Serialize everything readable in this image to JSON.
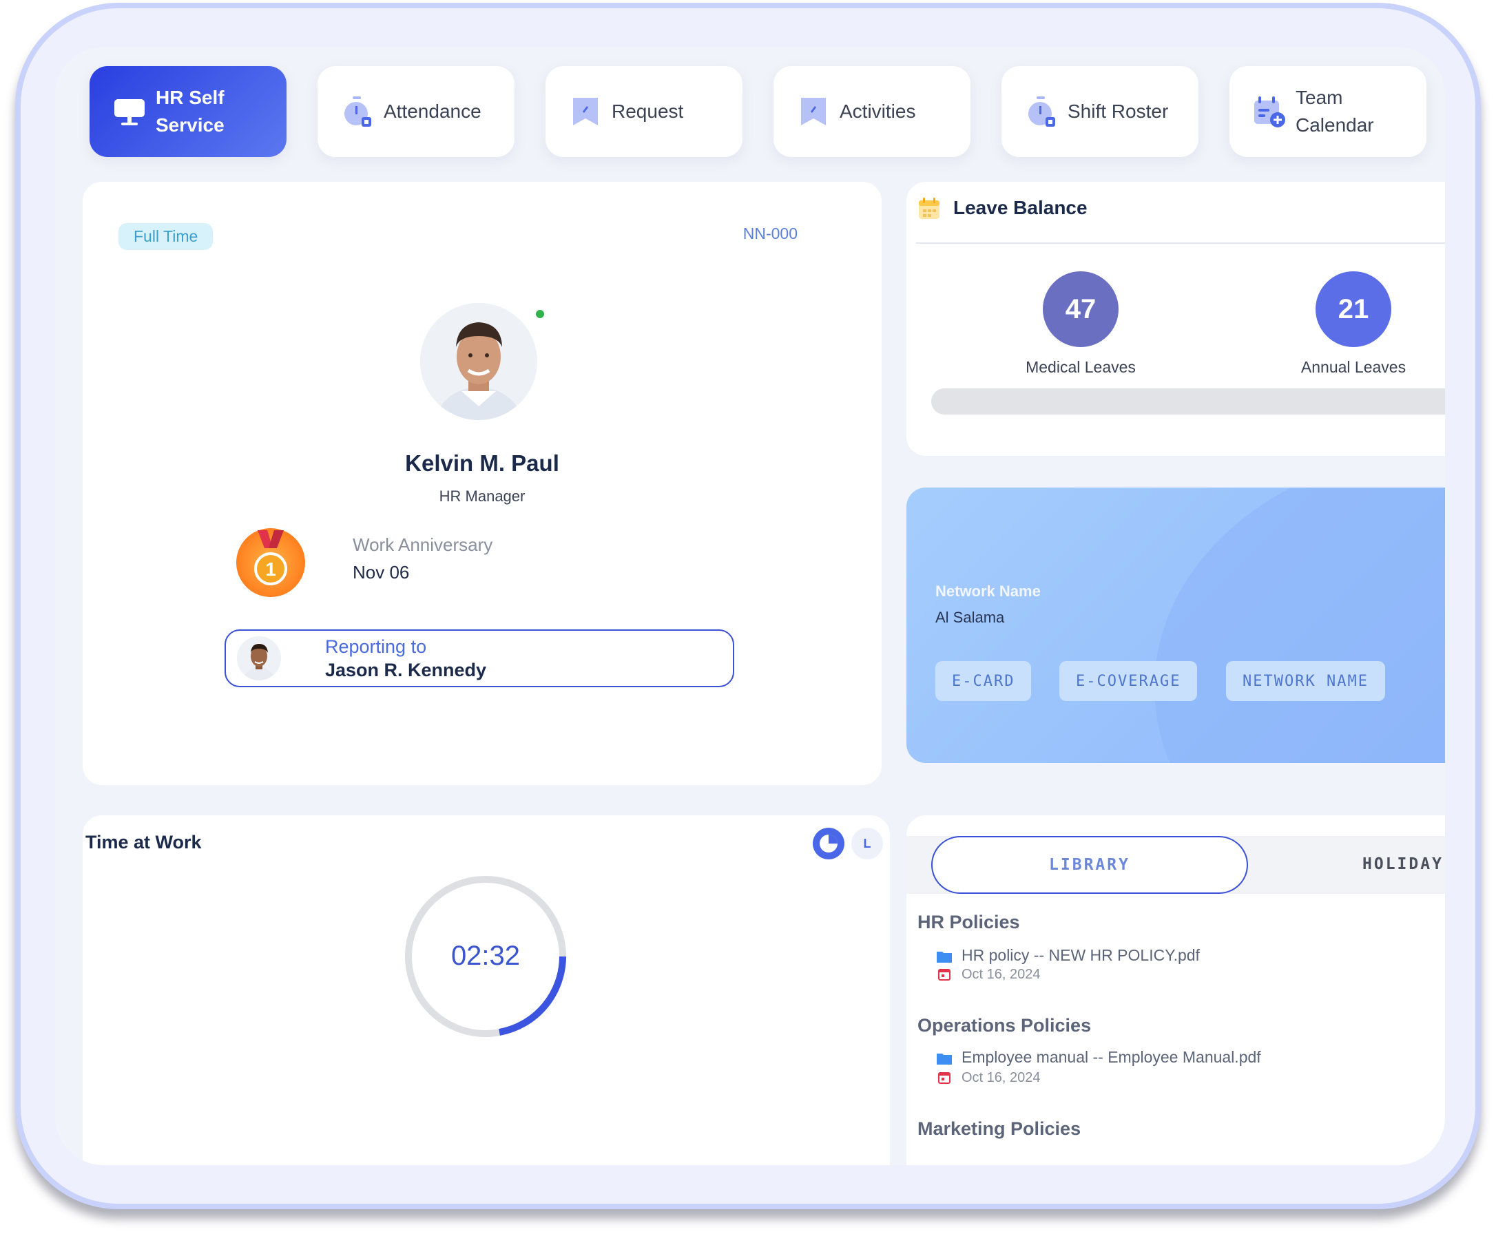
{
  "tabs": [
    {
      "label": "HR Self\nService",
      "icon": "monitor-icon"
    },
    {
      "label": "Attendance",
      "icon": "stopwatch-icon"
    },
    {
      "label": "Request",
      "icon": "bookmark-icon"
    },
    {
      "label": "Activities",
      "icon": "bookmark-icon"
    },
    {
      "label": "Shift Roster",
      "icon": "stopwatch-icon"
    },
    {
      "label": "Team\nCalendar",
      "icon": "calendar-add-icon"
    }
  ],
  "profile": {
    "employment_type": "Full Time",
    "employee_id": "NN-000",
    "name": "Kelvin M. Paul",
    "role": "HR Manager",
    "anniversary_title": "Work Anniversary",
    "anniversary_date": "Nov 06",
    "medal_number": "1",
    "reporting_label": "Reporting to",
    "reporting_name": "Jason R. Kennedy"
  },
  "leave_balance": {
    "title": "Leave Balance",
    "items": [
      {
        "value": "47",
        "label": "Medical Leaves",
        "color": "#6a6fc2"
      },
      {
        "value": "21",
        "label": "Annual Leaves",
        "color": "#5b6ee8"
      }
    ]
  },
  "insurance": {
    "network_label": "Network Name",
    "network_value": "Al Salama",
    "buttons": [
      "E-CARD",
      "E-COVERAGE",
      "NETWORK NAME"
    ]
  },
  "time_at_work": {
    "title": "Time at Work",
    "time": "02:32",
    "toggle_label": "L"
  },
  "library": {
    "tabs": [
      "LIBRARY",
      "HOLIDAY"
    ],
    "sections": [
      {
        "title": "HR Policies",
        "doc": "HR policy -- NEW HR POLICY.pdf",
        "date": "Oct 16, 2024"
      },
      {
        "title": "Operations Policies",
        "doc": "Employee manual -- Employee Manual.pdf",
        "date": "Oct 16, 2024"
      },
      {
        "title": "Marketing Policies"
      }
    ]
  },
  "colors": {
    "accent": "#3b50d8",
    "active_tab_start": "#2a3fe0",
    "active_tab_end": "#5b78f0",
    "insurance_bg": "#a5cdfd"
  }
}
